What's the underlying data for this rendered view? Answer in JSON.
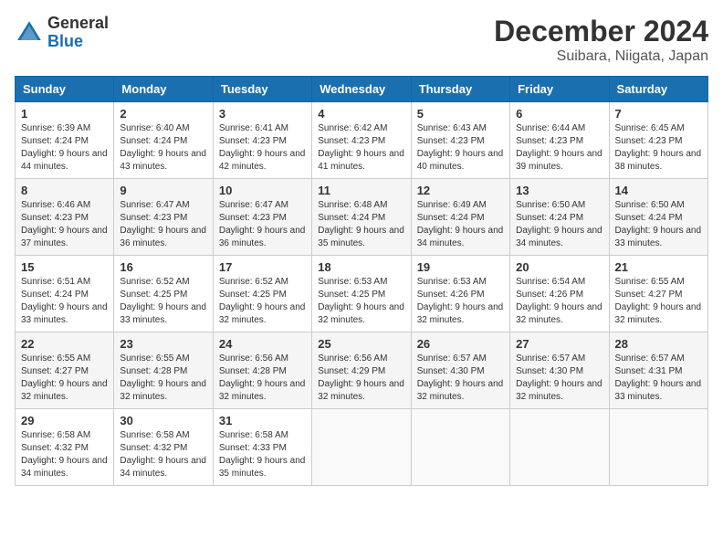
{
  "logo": {
    "text_general": "General",
    "text_blue": "Blue"
  },
  "title": "December 2024",
  "subtitle": "Suibara, Niigata, Japan",
  "days_of_week": [
    "Sunday",
    "Monday",
    "Tuesday",
    "Wednesday",
    "Thursday",
    "Friday",
    "Saturday"
  ],
  "weeks": [
    [
      {
        "day": 1,
        "sunrise": "6:39 AM",
        "sunset": "4:24 PM",
        "daylight": "9 hours and 44 minutes."
      },
      {
        "day": 2,
        "sunrise": "6:40 AM",
        "sunset": "4:24 PM",
        "daylight": "9 hours and 43 minutes."
      },
      {
        "day": 3,
        "sunrise": "6:41 AM",
        "sunset": "4:23 PM",
        "daylight": "9 hours and 42 minutes."
      },
      {
        "day": 4,
        "sunrise": "6:42 AM",
        "sunset": "4:23 PM",
        "daylight": "9 hours and 41 minutes."
      },
      {
        "day": 5,
        "sunrise": "6:43 AM",
        "sunset": "4:23 PM",
        "daylight": "9 hours and 40 minutes."
      },
      {
        "day": 6,
        "sunrise": "6:44 AM",
        "sunset": "4:23 PM",
        "daylight": "9 hours and 39 minutes."
      },
      {
        "day": 7,
        "sunrise": "6:45 AM",
        "sunset": "4:23 PM",
        "daylight": "9 hours and 38 minutes."
      }
    ],
    [
      {
        "day": 8,
        "sunrise": "6:46 AM",
        "sunset": "4:23 PM",
        "daylight": "9 hours and 37 minutes."
      },
      {
        "day": 9,
        "sunrise": "6:47 AM",
        "sunset": "4:23 PM",
        "daylight": "9 hours and 36 minutes."
      },
      {
        "day": 10,
        "sunrise": "6:47 AM",
        "sunset": "4:23 PM",
        "daylight": "9 hours and 36 minutes."
      },
      {
        "day": 11,
        "sunrise": "6:48 AM",
        "sunset": "4:24 PM",
        "daylight": "9 hours and 35 minutes."
      },
      {
        "day": 12,
        "sunrise": "6:49 AM",
        "sunset": "4:24 PM",
        "daylight": "9 hours and 34 minutes."
      },
      {
        "day": 13,
        "sunrise": "6:50 AM",
        "sunset": "4:24 PM",
        "daylight": "9 hours and 34 minutes."
      },
      {
        "day": 14,
        "sunrise": "6:50 AM",
        "sunset": "4:24 PM",
        "daylight": "9 hours and 33 minutes."
      }
    ],
    [
      {
        "day": 15,
        "sunrise": "6:51 AM",
        "sunset": "4:24 PM",
        "daylight": "9 hours and 33 minutes."
      },
      {
        "day": 16,
        "sunrise": "6:52 AM",
        "sunset": "4:25 PM",
        "daylight": "9 hours and 33 minutes."
      },
      {
        "day": 17,
        "sunrise": "6:52 AM",
        "sunset": "4:25 PM",
        "daylight": "9 hours and 32 minutes."
      },
      {
        "day": 18,
        "sunrise": "6:53 AM",
        "sunset": "4:25 PM",
        "daylight": "9 hours and 32 minutes."
      },
      {
        "day": 19,
        "sunrise": "6:53 AM",
        "sunset": "4:26 PM",
        "daylight": "9 hours and 32 minutes."
      },
      {
        "day": 20,
        "sunrise": "6:54 AM",
        "sunset": "4:26 PM",
        "daylight": "9 hours and 32 minutes."
      },
      {
        "day": 21,
        "sunrise": "6:55 AM",
        "sunset": "4:27 PM",
        "daylight": "9 hours and 32 minutes."
      }
    ],
    [
      {
        "day": 22,
        "sunrise": "6:55 AM",
        "sunset": "4:27 PM",
        "daylight": "9 hours and 32 minutes."
      },
      {
        "day": 23,
        "sunrise": "6:55 AM",
        "sunset": "4:28 PM",
        "daylight": "9 hours and 32 minutes."
      },
      {
        "day": 24,
        "sunrise": "6:56 AM",
        "sunset": "4:28 PM",
        "daylight": "9 hours and 32 minutes."
      },
      {
        "day": 25,
        "sunrise": "6:56 AM",
        "sunset": "4:29 PM",
        "daylight": "9 hours and 32 minutes."
      },
      {
        "day": 26,
        "sunrise": "6:57 AM",
        "sunset": "4:30 PM",
        "daylight": "9 hours and 32 minutes."
      },
      {
        "day": 27,
        "sunrise": "6:57 AM",
        "sunset": "4:30 PM",
        "daylight": "9 hours and 32 minutes."
      },
      {
        "day": 28,
        "sunrise": "6:57 AM",
        "sunset": "4:31 PM",
        "daylight": "9 hours and 33 minutes."
      }
    ],
    [
      {
        "day": 29,
        "sunrise": "6:58 AM",
        "sunset": "4:32 PM",
        "daylight": "9 hours and 34 minutes."
      },
      {
        "day": 30,
        "sunrise": "6:58 AM",
        "sunset": "4:32 PM",
        "daylight": "9 hours and 34 minutes."
      },
      {
        "day": 31,
        "sunrise": "6:58 AM",
        "sunset": "4:33 PM",
        "daylight": "9 hours and 35 minutes."
      },
      null,
      null,
      null,
      null
    ]
  ]
}
